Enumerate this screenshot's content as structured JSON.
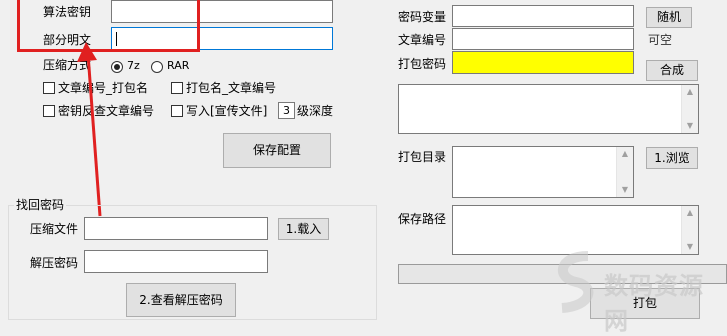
{
  "left": {
    "algo_key_label": "算法密钥",
    "algo_key_value": "",
    "partial_plain_label": "部分明文",
    "partial_plain_value": "",
    "compress_mode_label": "压缩方式",
    "radio_7z": "7z",
    "radio_rar": "RAR",
    "chk_article_pack": "文章编号_打包名",
    "chk_pack_article": "打包名_文章编号",
    "chk_key_lookup": "密钥反查文章编号",
    "chk_write_promo": "写入[宣传文件]",
    "depth_value": "3",
    "depth_label": "级深度",
    "save_config": "保存配置"
  },
  "retrieve": {
    "group_title": "找回密码",
    "archive_label": "压缩文件",
    "archive_value": "",
    "load_button": "1.载入",
    "extract_pwd_label": "解压密码",
    "extract_pwd_value": "",
    "view_button": "2.查看解压密码"
  },
  "right": {
    "pwd_var_label": "密码变量",
    "random_button": "随机",
    "article_no_label": "文章编号",
    "optional_note": "可空",
    "pack_pwd_label": "打包密码",
    "compose_button": "合成",
    "pack_dir_label": "打包目录",
    "browse_button": "1.浏览",
    "save_path_label": "保存路径",
    "bottom_button": "打包"
  },
  "watermark": {
    "text": "数码资源网"
  },
  "colors": {
    "yellow_field": "#ffff00",
    "highlight_red": "#e02020",
    "focus_blue": "#0078d7"
  }
}
